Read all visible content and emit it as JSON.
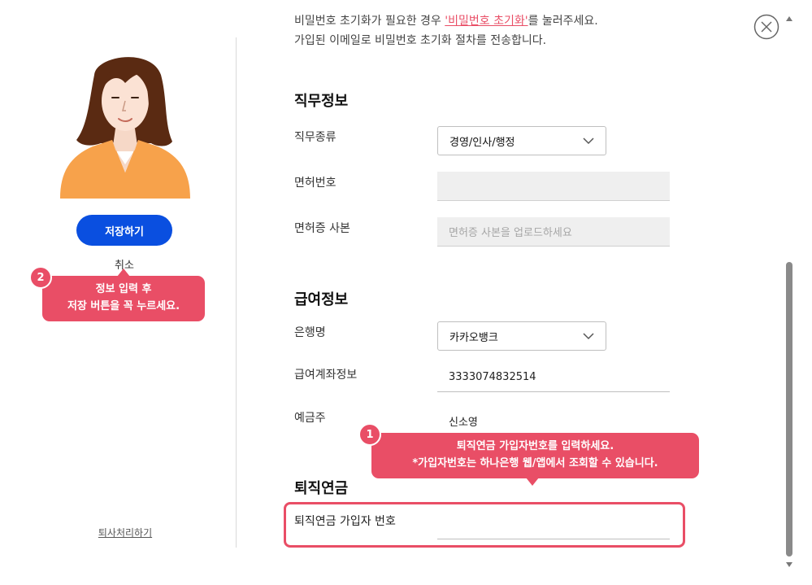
{
  "sidebar": {
    "save_label": "저장하기",
    "cancel_label": "취소",
    "resign_label": "퇴사처리하기"
  },
  "tooltip_save": {
    "number": "2",
    "line1": "정보 입력 후",
    "line2": "저장 버튼을 꼭 누르세요."
  },
  "notice": {
    "line1_before": "비밀번호 초기화가 필요한 경우 ",
    "line1_link": "'비밀번호 초기화'",
    "line1_after": "를 눌러주세요.",
    "line2": "가입된 이메일로 비밀번호 초기화 절차를 전송합니다."
  },
  "job_info": {
    "title": "직무정보",
    "job_type_label": "직무종류",
    "job_type_value": "경영/인사/행정",
    "license_number_label": "면허번호",
    "license_number_value": "",
    "license_copy_label": "면허증 사본",
    "license_copy_placeholder": "면허증 사본을 업로드하세요"
  },
  "salary_info": {
    "title": "급여정보",
    "bank_label": "은행명",
    "bank_value": "카카오뱅크",
    "account_label": "급여계좌정보",
    "account_value": "3333074832514",
    "holder_label": "예금주",
    "holder_value": "신소영"
  },
  "tooltip_pension": {
    "number": "1",
    "line1": "퇴직연금 가입자번호를 입력하세요.",
    "line2": "*가입자번호는 하나은행 웹/앱에서 조회할 수 있습니다."
  },
  "pension": {
    "title": "퇴직연금",
    "member_number_label": "퇴직연금 가입자 번호",
    "member_number_value": ""
  },
  "colors": {
    "primary": "#0a4fe0",
    "accent": "#e94e66"
  },
  "icons": [
    "avatar-woman",
    "close-icon",
    "chevron-down-icon"
  ]
}
